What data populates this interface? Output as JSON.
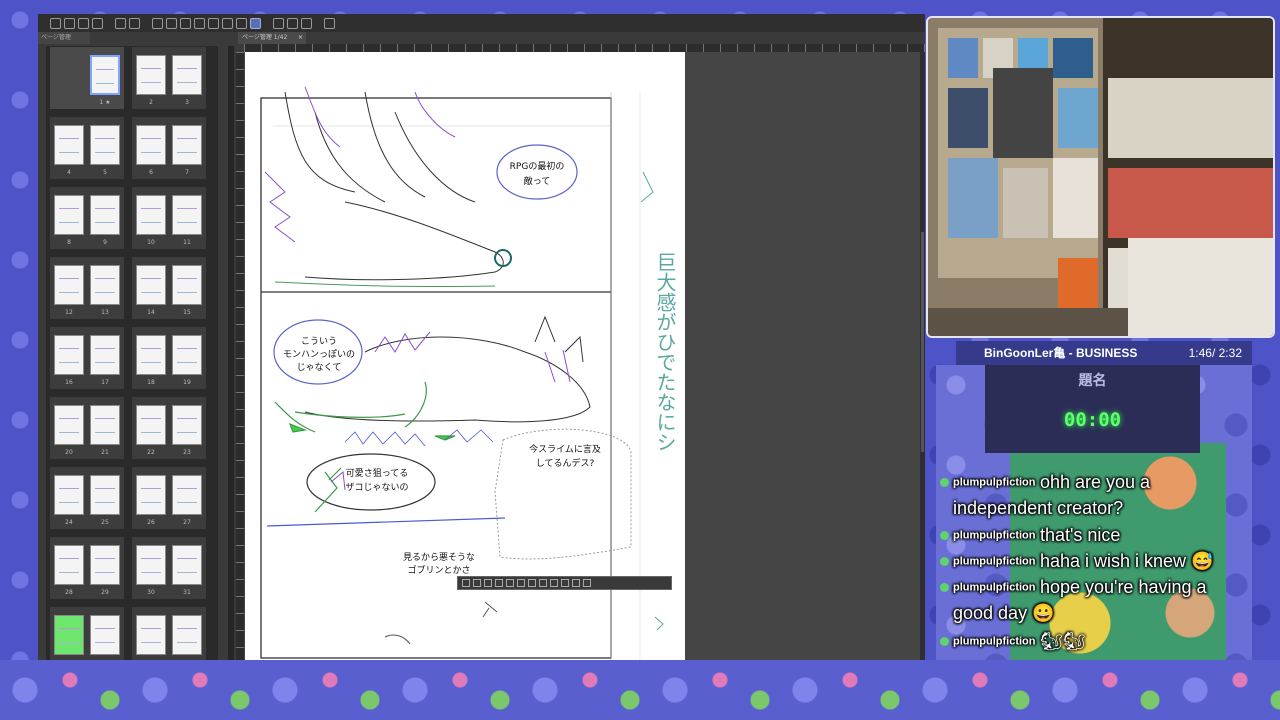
{
  "app": {
    "panel_tab": "ページ管理",
    "doc_tab": "ページ管理 1/42",
    "doc_tab_close": "×",
    "pages": [
      {
        "labels": [
          "1 ★"
        ],
        "thumbs": 1
      },
      {
        "labels": [
          "2",
          "3"
        ],
        "thumbs": 2
      },
      {
        "labels": [
          "4",
          "5"
        ],
        "thumbs": 2
      },
      {
        "labels": [
          "6",
          "7"
        ],
        "thumbs": 2
      },
      {
        "labels": [
          "8",
          "9"
        ],
        "thumbs": 2
      },
      {
        "labels": [
          "10",
          "11"
        ],
        "thumbs": 2
      },
      {
        "labels": [
          "12",
          "13"
        ],
        "thumbs": 2
      },
      {
        "labels": [
          "14",
          "15"
        ],
        "thumbs": 2
      },
      {
        "labels": [
          "16",
          "17"
        ],
        "thumbs": 2
      },
      {
        "labels": [
          "18",
          "19"
        ],
        "thumbs": 2
      },
      {
        "labels": [
          "20",
          "21"
        ],
        "thumbs": 2
      },
      {
        "labels": [
          "22",
          "23"
        ],
        "thumbs": 2
      },
      {
        "labels": [
          "24",
          "25"
        ],
        "thumbs": 2
      },
      {
        "labels": [
          "26",
          "27"
        ],
        "thumbs": 2
      },
      {
        "labels": [
          "28",
          "29"
        ],
        "thumbs": 2
      },
      {
        "labels": [
          "30",
          "31"
        ],
        "thumbs": 2
      },
      {
        "labels": [
          "",
          ""
        ],
        "thumbs": 2
      },
      {
        "labels": [
          "",
          ""
        ],
        "thumbs": 2
      }
    ],
    "bubbles": {
      "b1_l1": "RPGの最初の",
      "b1_l2": "敵って",
      "b2_l1": "こういう",
      "b2_l2": "モンハンっぽいの",
      "b2_l3": "じゃなくて",
      "b3_l1": "可愛さ狙ってる",
      "b3_l2": "ザコじゃないの",
      "b4_l1": "今スライムに言及",
      "b4_l2": "してるんデス?",
      "b5_l1": "見るから悪そうな",
      "b5_l2": "ゴブリンとかさ"
    },
    "handwriting": "巨大感がひでたなにシ"
  },
  "stream": {
    "title": "BinGoonLer亀 - BUSINESS",
    "time": "1:46/ 2:32",
    "timer_label": "題名",
    "timer_value": "00:00",
    "chat": [
      {
        "user": "plumpulpfiction",
        "msg": "ohh are you a",
        "cont": "independent creator?"
      },
      {
        "user": "plumpulpfiction",
        "msg": "that's nice",
        "cont": ""
      },
      {
        "user": "plumpulpfiction",
        "msg": "haha i wish i knew 😅",
        "cont": ""
      },
      {
        "user": "plumpulpfiction",
        "msg": "hope you're having a",
        "cont": "good day 😀"
      },
      {
        "user": "plumpulpfiction",
        "msg": "🐿🐿",
        "cont": ""
      }
    ]
  }
}
